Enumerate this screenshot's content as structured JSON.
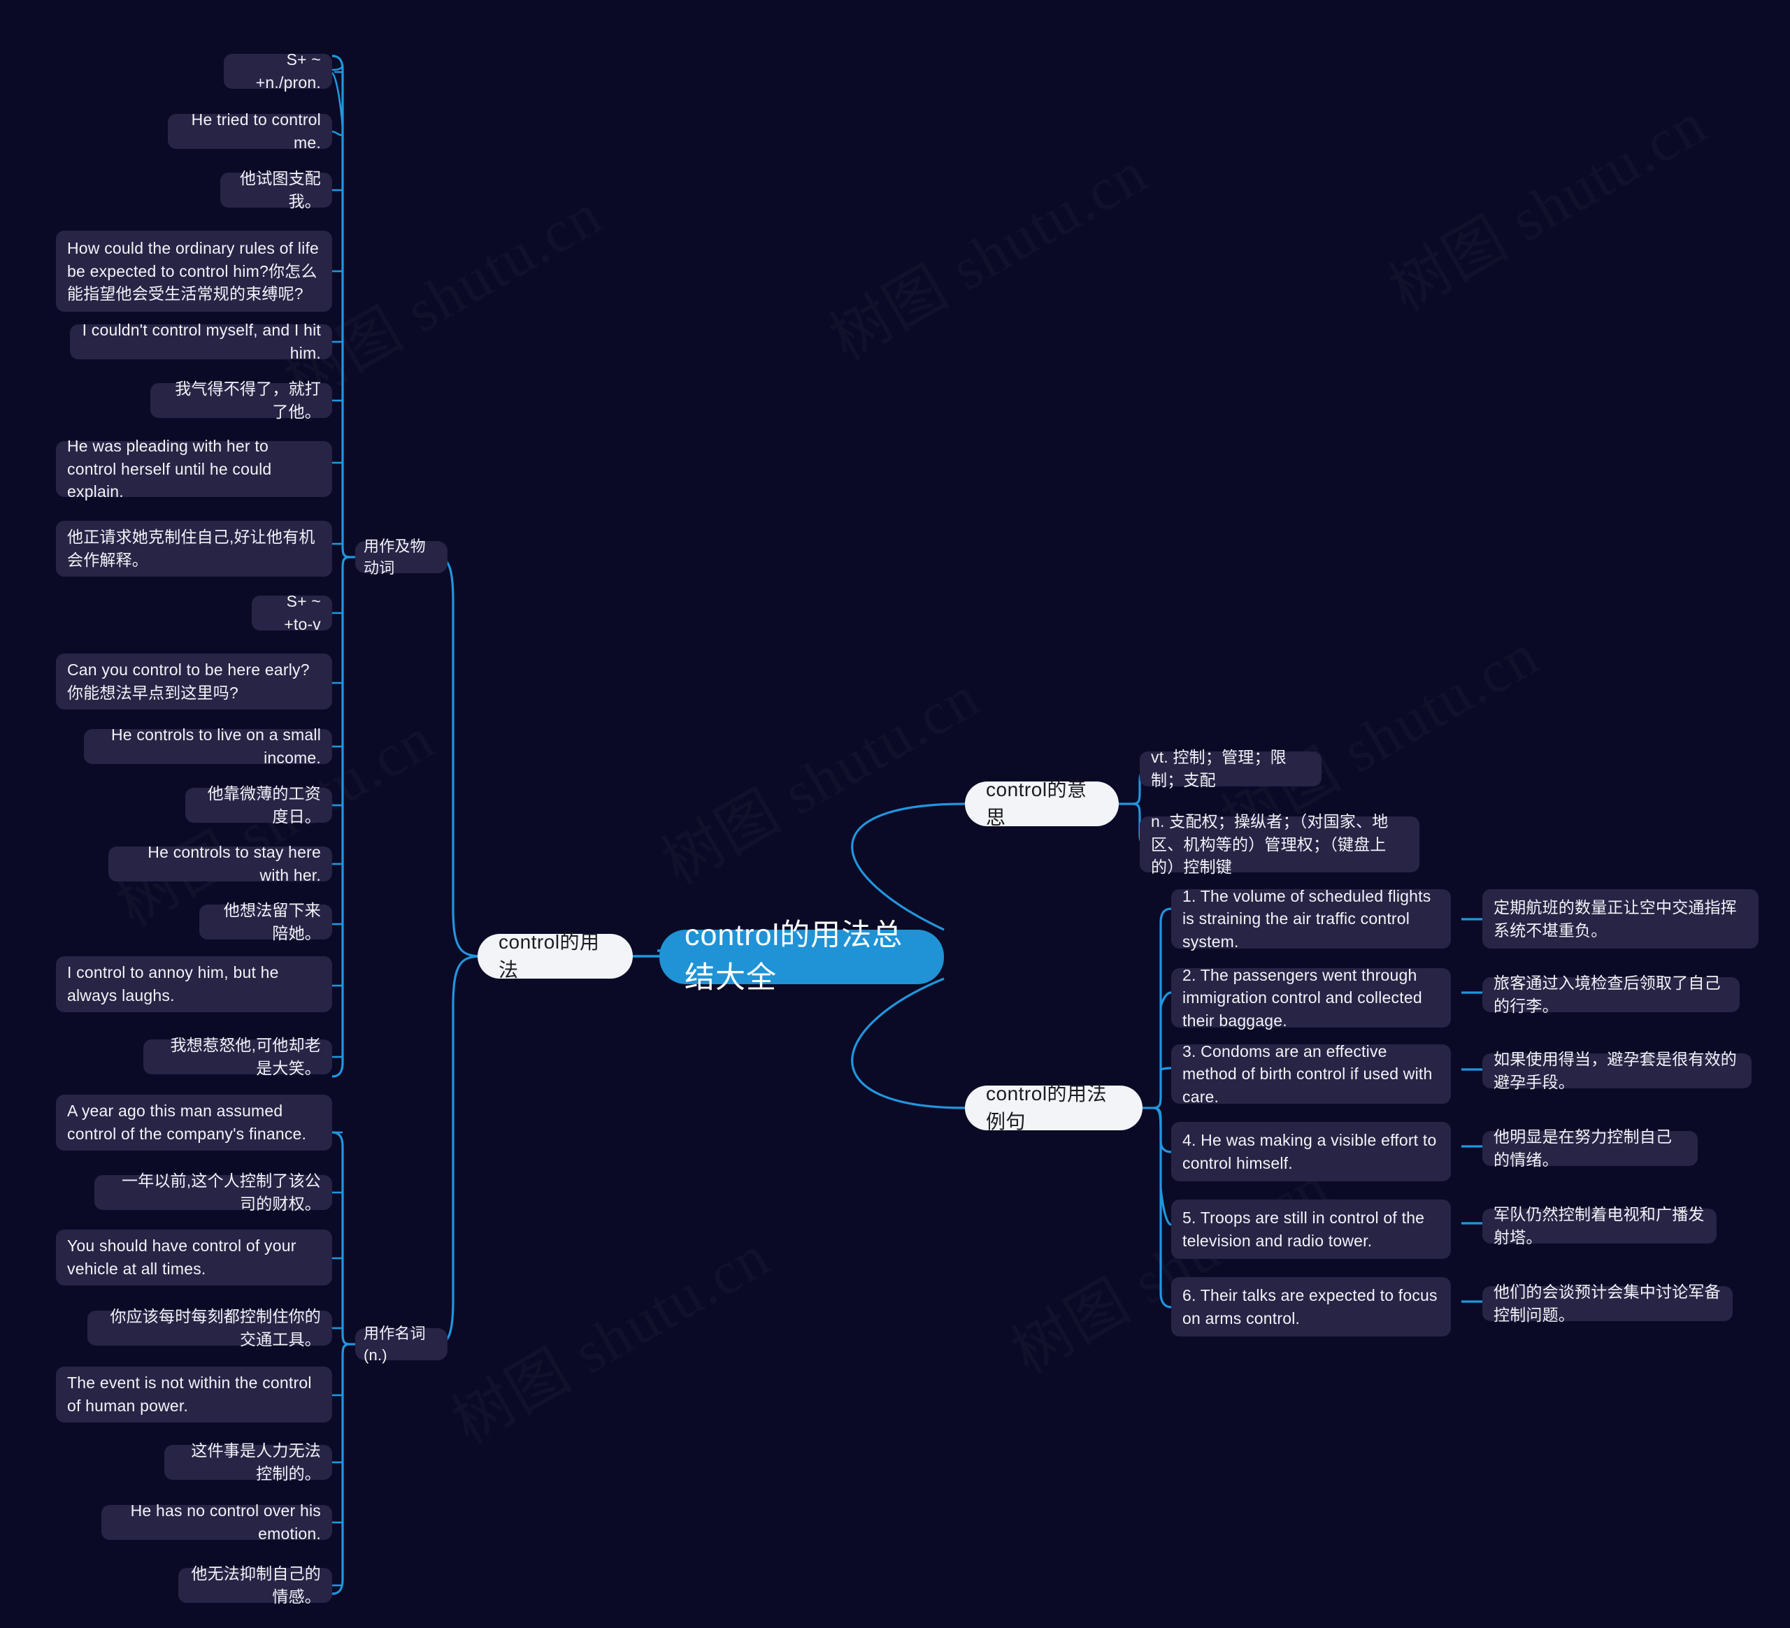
{
  "meta": {
    "watermark": "树图 shutu.cn",
    "accent_color": "#2196dd",
    "root_color": "#1f93d6",
    "node_color": "#272445",
    "background_color": "#0b0a26",
    "pill_color": "#f3f4f8"
  },
  "root": {
    "label": "control的用法总结大全"
  },
  "branches": {
    "usage": {
      "label": "control的用法"
    },
    "meaning": {
      "label": "control的意思"
    },
    "examples": {
      "label": "control的用法例句"
    }
  },
  "usage": {
    "transitive": {
      "label": "用作及物动词",
      "items": [
        {
          "text": "S+ ~ +n./pron."
        },
        {
          "text": "He tried to control me."
        },
        {
          "text": "他试图支配我。"
        },
        {
          "text": "How could the ordinary rules of life be expected to control him?你怎么能指望他会受生活常规的束缚呢?"
        },
        {
          "text": "I couldn't control myself, and I hit him."
        },
        {
          "text": "我气得不得了，就打了他。"
        },
        {
          "text": "He was pleading with her to control herself until he could explain."
        },
        {
          "text": "他正请求她克制住自己,好让他有机会作解释。"
        },
        {
          "text": "S+ ~ +to-v"
        },
        {
          "text": "Can you control to be here early?你能想法早点到这里吗?"
        },
        {
          "text": "He controls to live on a small income."
        },
        {
          "text": "他靠微薄的工资度日。"
        },
        {
          "text": "He controls to stay here with her."
        },
        {
          "text": "他想法留下来陪她。"
        },
        {
          "text": "I control to annoy him, but he always laughs."
        },
        {
          "text": "我想惹怒他,可他却老是大笑。"
        }
      ]
    },
    "noun": {
      "label": "用作名词(n.)",
      "items": [
        {
          "text": "A year ago this man assumed control of the company's finance."
        },
        {
          "text": "一年以前,这个人控制了该公司的财权。"
        },
        {
          "text": "You should have control of your vehicle at all times."
        },
        {
          "text": "你应该每时每刻都控制住你的交通工具。"
        },
        {
          "text": "The event is not within the control of human power."
        },
        {
          "text": "这件事是人力无法控制的。"
        },
        {
          "text": "He has no control over his emotion."
        },
        {
          "text": "他无法抑制自己的情感。"
        }
      ]
    }
  },
  "meaning": {
    "items": [
      {
        "text": "vt. 控制；管理；限制；支配"
      },
      {
        "text": "n. 支配权；操纵者；（对国家、地区、机构等的）管理权；（键盘上的）控制键"
      }
    ]
  },
  "examples": {
    "items": [
      {
        "en": "1. The volume of scheduled flights is straining the air traffic control system.",
        "zh": "定期航班的数量正让空中交通指挥系统不堪重负。"
      },
      {
        "en": "2. The passengers went through immigration control and collected their baggage.",
        "zh": "旅客通过入境检查后领取了自己的行李。"
      },
      {
        "en": "3. Condoms are an effective method of birth control if used with care.",
        "zh": "如果使用得当，避孕套是很有效的避孕手段。"
      },
      {
        "en": "4. He was making a visible effort to control himself.",
        "zh": "他明显是在努力控制自己的情绪。"
      },
      {
        "en": "5. Troops are still in control of the television and radio tower.",
        "zh": "军队仍然控制着电视和广播发射塔。"
      },
      {
        "en": "6. Their talks are expected to focus on arms control.",
        "zh": "他们的会谈预计会集中讨论军备控制问题。"
      }
    ]
  }
}
